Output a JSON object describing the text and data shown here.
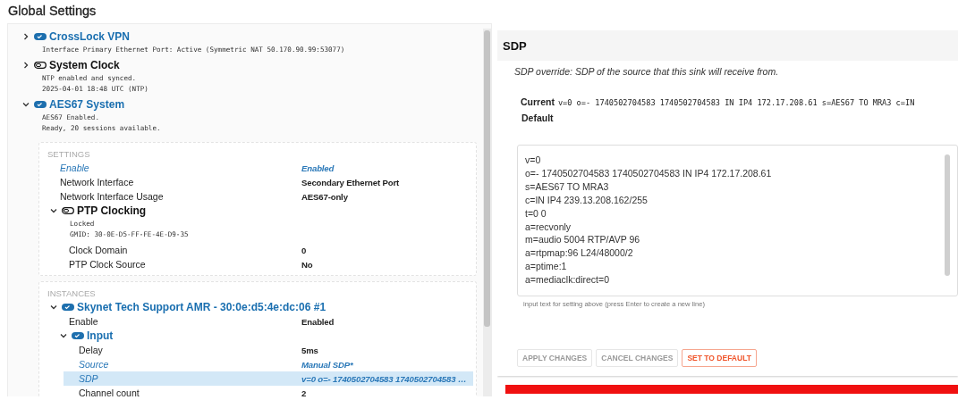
{
  "page_title": "Global Settings",
  "tree": [
    {
      "title": "CrossLock VPN",
      "enabled": true,
      "expanded": false,
      "details": [
        "Interface Primary Ethernet Port: Active (Symmetric NAT 50.170.90.99:53077)"
      ]
    },
    {
      "title": "System Clock",
      "enabled": false,
      "expanded": false,
      "details": [
        "NTP enabled and synced.",
        "2025-04-01 18:48 UTC (NTP)"
      ]
    },
    {
      "title": "AES67 System",
      "enabled": true,
      "expanded": true,
      "details": [
        "AES67 Enabled.",
        "Ready, 20 sessions available."
      ]
    }
  ],
  "settings_section": {
    "heading": "SETTINGS",
    "rows": [
      {
        "label": "Enable",
        "value": "Enabled",
        "modified": true,
        "selected": false
      },
      {
        "label": "Network Interface",
        "value": "Secondary Ethernet Port",
        "modified": false,
        "selected": false
      },
      {
        "label": "Network Interface Usage",
        "value": "AES67-only",
        "modified": false,
        "selected": false
      }
    ],
    "group": {
      "title": "PTP Clocking",
      "enabled": false,
      "expanded": true,
      "details": [
        "Locked",
        "GMID: 30-0E-D5-FF-FE-4E-D9-35"
      ],
      "rows": [
        {
          "label": "Clock Domain",
          "value": "0",
          "modified": false,
          "selected": false
        },
        {
          "label": "PTP Clock Source",
          "value": "No",
          "modified": false,
          "selected": false
        }
      ]
    }
  },
  "instances_section": {
    "heading": "INSTANCES",
    "instance": {
      "title": "Skynet Tech Support AMR - 30:0e:d5:4e:dc:06 #1",
      "enabled": true,
      "expanded": true,
      "rows": [
        {
          "label": "Enable",
          "value": "Enabled",
          "modified": false,
          "selected": false
        }
      ],
      "group": {
        "title": "Input",
        "enabled": true,
        "expanded": true,
        "rows": [
          {
            "label": "Delay",
            "value": "5ms",
            "modified": false,
            "selected": false
          },
          {
            "label": "Source",
            "value": "Manual SDP*",
            "modified": true,
            "selected": false
          },
          {
            "label": "SDP",
            "value": "v=0 o=- 1740502704583 1740502704583 …",
            "modified": true,
            "selected": true
          },
          {
            "label": "Channel count",
            "value": "2",
            "modified": false,
            "selected": false
          }
        ]
      }
    }
  },
  "sdp_panel": {
    "title": "SDP",
    "description": "SDP override: SDP of the source that this sink will receive from.",
    "current_label": "Current",
    "current_value": "v=0 o=- 1740502704583 1740502704583 IN IP4 172.17.208.61 s=AES67 TO MRA3 c=IN",
    "default_label": "Default",
    "value_lines": [
      "v=0",
      "o=- 1740502704583 1740502704583 IN IP4 172.17.208.61",
      "s=AES67 TO MRA3",
      "c=IN IP4 239.13.208.162/255",
      "t=0 0",
      "a=recvonly",
      "m=audio 5004 RTP/AVP 96",
      "a=rtpmap:96 L24/48000/2",
      "a=ptime:1",
      "a=mediaclk:direct=0"
    ],
    "hint": "input text for setting above (press Enter to create a new line)",
    "buttons": [
      {
        "label": "APPLY CHANGES",
        "disabled": true,
        "kind": "normal"
      },
      {
        "label": "CANCEL CHANGES",
        "disabled": true,
        "kind": "normal"
      },
      {
        "label": "SET TO DEFAULT",
        "disabled": false,
        "kind": "warning"
      }
    ]
  }
}
